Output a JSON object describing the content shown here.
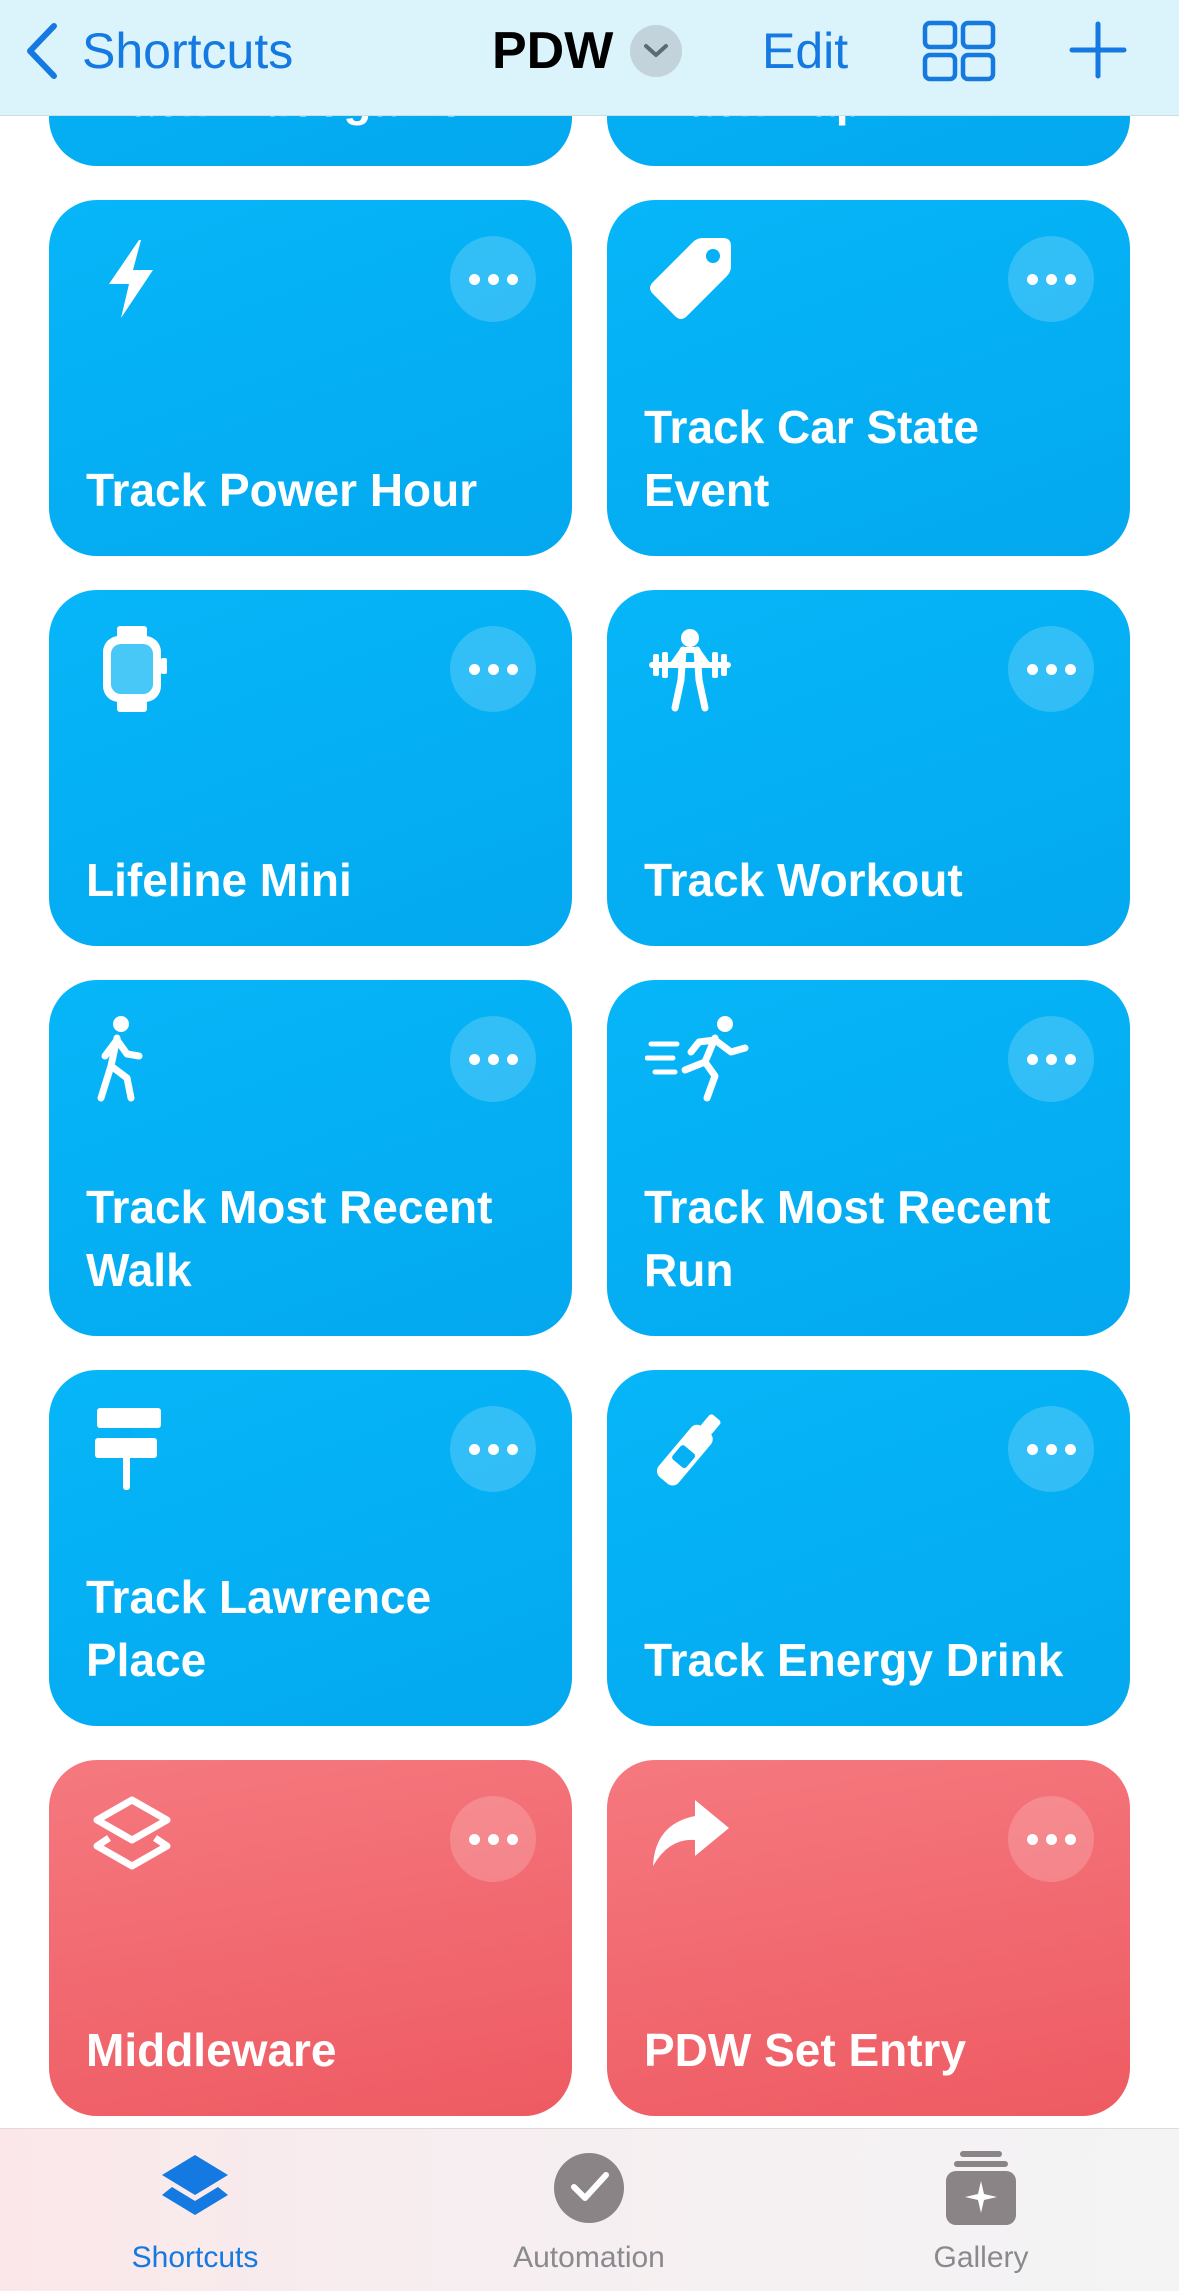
{
  "navbar": {
    "back_label": "Shortcuts",
    "title": "PDW",
    "edit_label": "Edit"
  },
  "partial_top": {
    "left": "Track Videogame",
    "right": "Track Nap"
  },
  "tiles": [
    {
      "label": "Track Power Hour",
      "icon": "bolt-icon",
      "color": "#05b0f5"
    },
    {
      "label": "Track Car State Event",
      "icon": "tag-icon",
      "color": "#05b0f5"
    },
    {
      "label": "Lifeline Mini",
      "icon": "watch-icon",
      "color": "#05b0f5"
    },
    {
      "label": "Track Workout",
      "icon": "weightlifting-icon",
      "color": "#05b0f5"
    },
    {
      "label": "Track Most Recent Walk",
      "icon": "walking-icon",
      "color": "#05b0f5"
    },
    {
      "label": "Track Most Recent Run",
      "icon": "running-icon",
      "color": "#05b0f5"
    },
    {
      "label": "Track Lawrence Place",
      "icon": "signpost-icon",
      "color": "#05b0f5"
    },
    {
      "label": "Track Energy Drink",
      "icon": "bottle-icon",
      "color": "#05b0f5"
    },
    {
      "label": "Middleware",
      "icon": "layers-icon",
      "color": "#f26a71"
    },
    {
      "label": "PDW Set Entry",
      "icon": "forward-arrow-icon",
      "color": "#f26a71"
    }
  ],
  "tabbar": {
    "shortcuts": "Shortcuts",
    "automation": "Automation",
    "gallery": "Gallery"
  },
  "colors": {
    "accent": "#1479e0",
    "tile_blue": "#05b0f5",
    "tile_red": "#f26a71"
  }
}
